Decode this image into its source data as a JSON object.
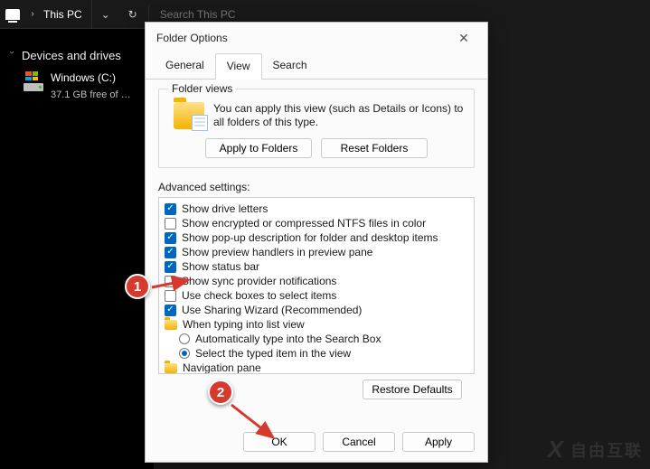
{
  "addressbar": {
    "location_label": "This PC",
    "search_placeholder": "Search This PC"
  },
  "navpane": {
    "section": "Devices and drives",
    "drive_name": "Windows (C:)",
    "drive_sub": "37.1 GB free of …"
  },
  "dialog": {
    "title": "Folder Options",
    "tabs": {
      "general": "General",
      "view": "View",
      "search": "Search"
    },
    "folder_views": {
      "legend": "Folder views",
      "desc": "You can apply this view (such as Details or Icons) to all folders of this type.",
      "apply": "Apply to Folders",
      "reset": "Reset Folders"
    },
    "advanced_label": "Advanced settings:",
    "settings": {
      "drive_letters": {
        "label": "Show drive letters",
        "checked": true
      },
      "ntfs_color": {
        "label": "Show encrypted or compressed NTFS files in color",
        "checked": false
      },
      "popup_desc": {
        "label": "Show pop-up description for folder and desktop items",
        "checked": true
      },
      "preview": {
        "label": "Show preview handlers in preview pane",
        "checked": true
      },
      "status_bar": {
        "label": "Show status bar",
        "checked": true
      },
      "sync_notif": {
        "label": "Show sync provider notifications",
        "checked": false
      },
      "checkboxes": {
        "label": "Use check boxes to select items",
        "checked": false
      },
      "sharing_wiz": {
        "label": "Use Sharing Wizard (Recommended)",
        "checked": true
      },
      "typing_group": "When typing into list view",
      "typing_auto": "Automatically type into the Search Box",
      "typing_select": "Select the typed item in the view",
      "nav_pane": "Navigation pane"
    },
    "restore": "Restore Defaults",
    "ok": "OK",
    "cancel": "Cancel",
    "apply_btn": "Apply"
  },
  "annotations": {
    "one": "1",
    "two": "2"
  },
  "watermark": "自由互联"
}
